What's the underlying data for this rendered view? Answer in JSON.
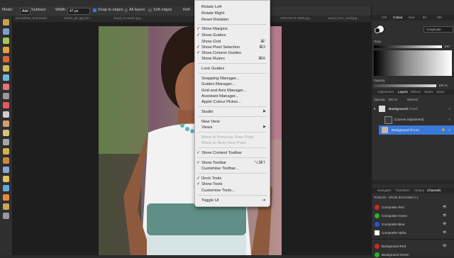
{
  "context_toolbar": {
    "mode_label": "Mode:",
    "mode_add": "Add",
    "mode_subtract": "Subtract",
    "width_label": "Width:",
    "width_value": "47 px",
    "snap_edges": "Snap to edges",
    "all_layers": "All layers",
    "soft_edges": "Soft edges",
    "refine": "Refi"
  },
  "doc_tabs": [
    "bernadette_thumbnail...",
    "tamku_pic.jpg (60...",
    "saudi_irnoea01.jpg...",
    "2015-03-11-0983.jpg...",
    "saudi_irnor_sunil.jpg"
  ],
  "menu": {
    "items": [
      {
        "label": "Rotate Left",
        "check": false,
        "shortcut": "",
        "submenu": false,
        "disabled": false
      },
      {
        "label": "Rotate Right",
        "check": false,
        "shortcut": "",
        "submenu": false,
        "disabled": false
      },
      {
        "label": "Reset Rotation",
        "check": false,
        "shortcut": "",
        "submenu": false,
        "disabled": false
      },
      {
        "label": "Show Margins",
        "check": true,
        "shortcut": "",
        "submenu": false,
        "disabled": false
      },
      {
        "label": "Show Guides",
        "check": true,
        "shortcut": "",
        "submenu": false,
        "disabled": false
      },
      {
        "label": "Show Grid",
        "check": false,
        "shortcut": "⌘'",
        "submenu": false,
        "disabled": false
      },
      {
        "label": "Show Pixel Selection",
        "check": true,
        "shortcut": "⌘3",
        "submenu": false,
        "disabled": false
      },
      {
        "label": "Show Column Guides",
        "check": true,
        "shortcut": "",
        "submenu": false,
        "disabled": false
      },
      {
        "label": "Show Rulers",
        "check": false,
        "shortcut": "⌘R",
        "submenu": false,
        "disabled": false
      },
      {
        "label": "Lock Guides",
        "check": false,
        "shortcut": "",
        "submenu": false,
        "disabled": false
      },
      {
        "label": "Snapping Manager...",
        "check": false,
        "shortcut": "",
        "submenu": false,
        "disabled": false
      },
      {
        "label": "Guides Manager...",
        "check": false,
        "shortcut": "",
        "submenu": false,
        "disabled": false
      },
      {
        "label": "Grid and Axis Manager...",
        "check": false,
        "shortcut": "",
        "submenu": false,
        "disabled": false
      },
      {
        "label": "Assistant Manager...",
        "check": false,
        "shortcut": "",
        "submenu": false,
        "disabled": false
      },
      {
        "label": "Apple Colour Picker...",
        "check": false,
        "shortcut": "",
        "submenu": false,
        "disabled": false
      },
      {
        "label": "Studio",
        "check": false,
        "shortcut": "",
        "submenu": true,
        "disabled": false
      },
      {
        "label": "New View",
        "check": false,
        "shortcut": "",
        "submenu": false,
        "disabled": false
      },
      {
        "label": "Views",
        "check": false,
        "shortcut": "",
        "submenu": true,
        "disabled": false
      },
      {
        "label": "Move to Previous View Point",
        "check": false,
        "shortcut": "",
        "submenu": false,
        "disabled": true
      },
      {
        "label": "Move to Next View Point",
        "check": false,
        "shortcut": "",
        "submenu": false,
        "disabled": true
      },
      {
        "label": "Show Context Toolbar",
        "check": true,
        "shortcut": "",
        "submenu": false,
        "disabled": false
      },
      {
        "label": "Show Toolbar",
        "check": true,
        "shortcut": "⌥⌘T",
        "submenu": false,
        "disabled": false
      },
      {
        "label": "Customise Toolbar...",
        "check": false,
        "shortcut": "",
        "submenu": false,
        "disabled": false
      },
      {
        "label": "Dock Tools",
        "check": true,
        "shortcut": "",
        "submenu": false,
        "disabled": false
      },
      {
        "label": "Show Tools",
        "check": true,
        "shortcut": "",
        "submenu": false,
        "disabled": false
      },
      {
        "label": "Customise Tools...",
        "check": false,
        "shortcut": "",
        "submenu": false,
        "disabled": false
      },
      {
        "label": "Toggle UI",
        "check": false,
        "shortcut": "⇥",
        "submenu": false,
        "disabled": false
      }
    ]
  },
  "colour_panel": {
    "tabs": [
      "Ctrl",
      "Colour",
      "Hue",
      "Bri",
      "Stk"
    ],
    "active_tab": "Colour",
    "mode": "Grayscale",
    "grey_label": "Grey",
    "grey_value": "100",
    "opacity_label": "Opacity",
    "opacity_value": "100 %"
  },
  "layers_panel": {
    "tabs": [
      "Adjustment",
      "Layers",
      "Effects",
      "Styles",
      "Stock"
    ],
    "active_tab": "Layers",
    "opacity_label": "Opacity:",
    "opacity_value": "100 %",
    "blend_mode": "Normal",
    "layers": [
      {
        "name": "Background",
        "kind": "(Pixel)"
      },
      {
        "name": "(Curves Adjustment)",
        "kind": ""
      },
      {
        "name": "Background",
        "kind": "(Pixel)"
      }
    ]
  },
  "channels_panel": {
    "tabs": [
      "Navigator",
      "Transform",
      "History",
      "Channels"
    ],
    "active_tab": "Channels",
    "profile": "RGBA/8 - sRGB IEC61966-2.1",
    "channels": [
      {
        "name": "Composite Red",
        "color": "#d0281f"
      },
      {
        "name": "Composite Green",
        "color": "#2db12a"
      },
      {
        "name": "Composite Blue",
        "color": "#2a52d8"
      },
      {
        "name": "Composite Alpha",
        "color": "#ffffff"
      },
      {
        "name": "Background Red",
        "color": "#d0281f"
      },
      {
        "name": "Background Green",
        "color": "#2db12a"
      }
    ]
  },
  "colors": {
    "accent": "#3a78d8",
    "menu_bg": "#eeeded",
    "panel_bg": "#2f2f2f"
  }
}
